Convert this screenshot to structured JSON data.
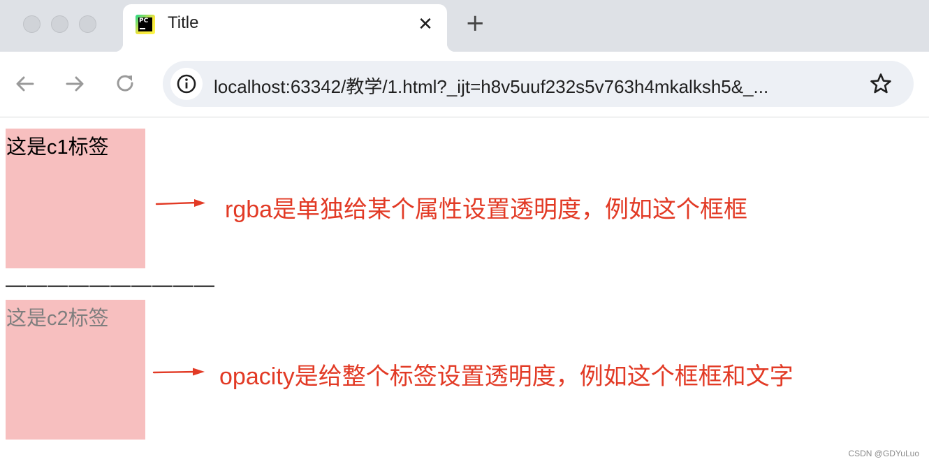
{
  "browser": {
    "tab": {
      "title": "Title",
      "favicon": "pycharm-icon",
      "favicon_text": "PC"
    },
    "address_bar": {
      "url": "localhost:63342/教学/1.html?_ijt=h8v5uuf232s5v763h4mkalksh5&_..."
    },
    "icons": {
      "back": "back-arrow-icon",
      "forward": "forward-arrow-icon",
      "reload": "reload-icon",
      "site_info": "info-icon",
      "bookmark": "star-icon",
      "close_tab": "close-icon",
      "new_tab": "plus-icon"
    }
  },
  "page": {
    "box1": {
      "label": "这是c1标签",
      "background": "rgba(240,128,128,0.5)"
    },
    "divider": "——————————",
    "box2": {
      "label": "这是c2标签",
      "background": "rgb(240,128,128)",
      "opacity": "0.5"
    },
    "annotations": {
      "note1": "rgba是单独给某个属性设置透明度，例如这个框框",
      "note2": "opacity是给整个标签设置透明度，例如这个框框和文字",
      "color": "#e23a25"
    }
  },
  "watermark": "CSDN @GDYuLuo"
}
